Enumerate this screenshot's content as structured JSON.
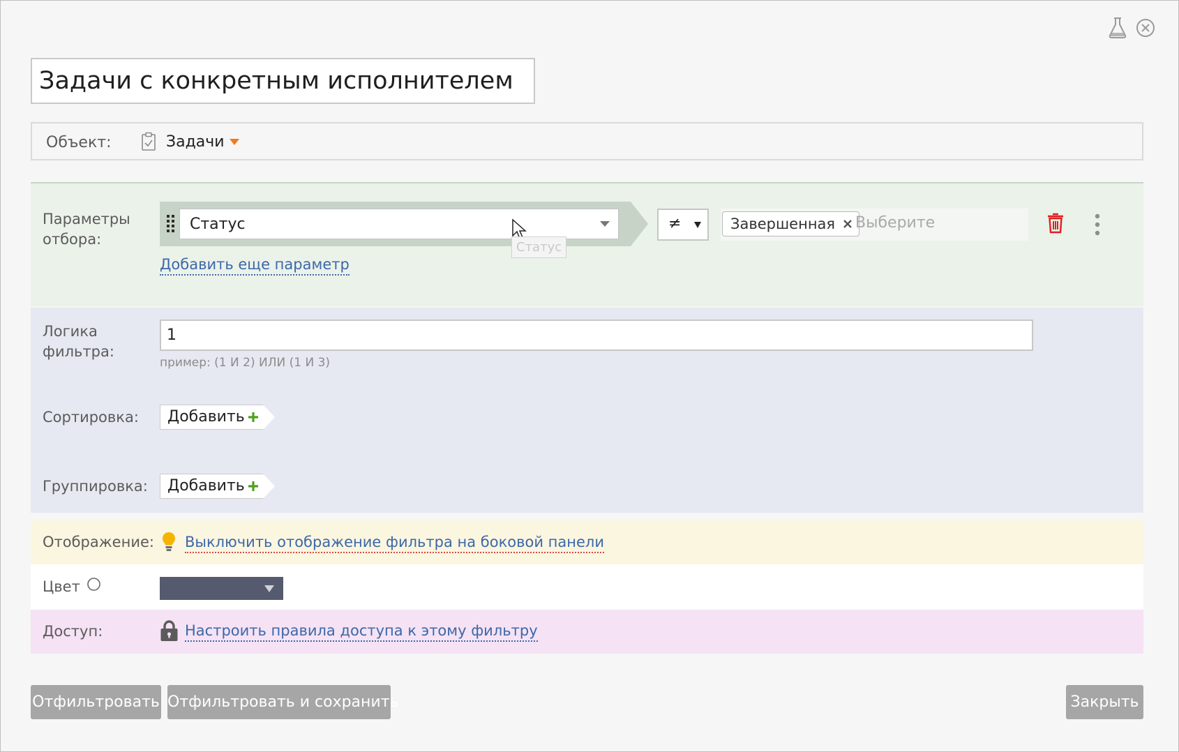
{
  "title": "Задачи с конкретным исполнителем",
  "object": {
    "label": "Объект:",
    "value": "Задачи",
    "icon": "clipboard-icon",
    "accent": "#f07a1d"
  },
  "params": {
    "label": "Параметры отбора:",
    "field": "Статус",
    "field_tooltip": "Статус",
    "operator": "≠",
    "values": [
      "Завершенная"
    ],
    "value_placeholder": "Выберите",
    "add_link": "Добавить еще параметр",
    "delete_color": "#e02020"
  },
  "logic": {
    "label": "Логика фильтра:",
    "value": "1",
    "hint": "пример: (1 И 2) ИЛИ (1 И 3)"
  },
  "sort": {
    "label": "Сортировка:",
    "add_label": "Добавить"
  },
  "group": {
    "label": "Группировка:",
    "add_label": "Добавить"
  },
  "display": {
    "label": "Отображение:",
    "link": "Выключить отображение фильтра на боковой панели"
  },
  "color": {
    "label": "Цвет",
    "selected": "#555a6e"
  },
  "access": {
    "label": "Доступ:",
    "link": "Настроить правила доступа к этому фильтру"
  },
  "buttons": {
    "filter": "Отфильтровать",
    "filter_save": "Отфильтровать и сохранить",
    "close": "Закрыть"
  }
}
